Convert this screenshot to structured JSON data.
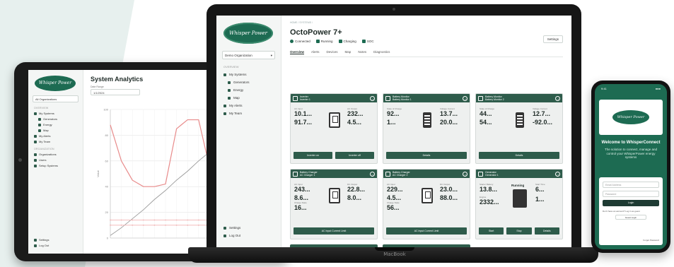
{
  "tablet": {
    "logo_text": "Whisper Power",
    "title": "System Analytics",
    "org_select": "All Organizations",
    "date_label": "Date Range",
    "date_value": "1/1/2024",
    "sidebar": {
      "section_overview": "OVERVIEW",
      "section_organization": "ORGANIZATION",
      "items": [
        {
          "label": "My Systems",
          "sub": false
        },
        {
          "label": "Generators",
          "sub": true
        },
        {
          "label": "Energy",
          "sub": true
        },
        {
          "label": "Map",
          "sub": true
        },
        {
          "label": "My Alerts",
          "sub": false
        },
        {
          "label": "My Team",
          "sub": false
        }
      ],
      "org_items": [
        {
          "label": "Organizations"
        },
        {
          "label": "Users"
        },
        {
          "label": "Setup Systems"
        }
      ],
      "bottom_items": [
        {
          "label": "Settings"
        },
        {
          "label": "Log Out"
        }
      ]
    },
    "chart_data": {
      "type": "line",
      "title": "",
      "xlabel": "",
      "ylabel": "Value",
      "x": [
        0,
        1,
        2,
        3,
        4,
        5,
        6,
        7,
        8,
        9,
        10,
        11,
        12,
        13,
        14,
        15
      ],
      "ylim": [
        0,
        100
      ],
      "yticks": [
        0,
        20,
        40,
        60,
        80,
        100
      ],
      "grid": true,
      "legend": "none",
      "series": [
        {
          "color": "#e88a8a",
          "values": [
            88,
            60,
            45,
            40,
            40,
            42,
            85,
            92,
            92,
            55,
            10,
            4,
            4,
            4,
            4,
            4
          ]
        },
        {
          "color": "#9a9a9a",
          "values": [
            2,
            8,
            15,
            22,
            30,
            37,
            45,
            52,
            60,
            67,
            75,
            82,
            88,
            93,
            97,
            99
          ]
        },
        {
          "color": "#f2b5b5",
          "values": [
            14,
            14,
            14,
            14,
            14,
            14,
            14,
            14,
            14,
            14,
            14,
            14,
            14,
            14,
            14,
            14
          ]
        },
        {
          "color": "#f2b5b5",
          "values": [
            10,
            10,
            10,
            10,
            10,
            10,
            10,
            10,
            10,
            10,
            10,
            10,
            10,
            10,
            10,
            10
          ]
        }
      ]
    }
  },
  "laptop": {
    "brand": "MacBook",
    "logo_text": "Whisper Power",
    "org_select": "Demo Organization",
    "breadcrumb": "HOME / SYSTEMS / ",
    "title": "OctoPower 7+",
    "settings_label": "Settings",
    "status": [
      {
        "label": "Connected",
        "shape": "circle"
      },
      {
        "label": "Running",
        "shape": "square"
      },
      {
        "label": "Charging",
        "shape": "square"
      },
      {
        "label": "SOC",
        "shape": "square"
      }
    ],
    "tabs": [
      "Overview",
      "Alerts",
      "Devices",
      "Map",
      "Notes",
      "Diagnostics"
    ],
    "active_tab": "Overview",
    "sidebar": {
      "section_overview": "OVERVIEW",
      "items": [
        {
          "label": "My Systems",
          "sub": false
        },
        {
          "label": "Generators",
          "sub": true
        },
        {
          "label": "Energy",
          "sub": true
        },
        {
          "label": "Map",
          "sub": true
        },
        {
          "label": "My Alerts",
          "sub": false
        },
        {
          "label": "My Team",
          "sub": false
        }
      ],
      "bottom_items": [
        {
          "label": "Settings"
        },
        {
          "label": "Log Out"
        }
      ]
    },
    "cards": [
      {
        "title": "Inverter",
        "subtitle": "Inverter 1",
        "icon": "inverter",
        "values": [
          {
            "label": "AC Input",
            "value": "10.1..."
          },
          {
            "label": "",
            "value": "91.7..."
          },
          {
            "label": "AC Output",
            "value": "232..."
          },
          {
            "label": "",
            "value": "4.5..."
          }
        ],
        "buttons": [
          "Inverter on",
          "Inverter off"
        ]
      },
      {
        "title": "Battery Monitor",
        "subtitle": "Battery Monitor 1",
        "icon": "battery",
        "values": [
          {
            "label": "State of Charge",
            "value": "92..."
          },
          {
            "label": "",
            "value": "1..."
          },
          {
            "label": "Voltage Current",
            "value": "13.7..."
          },
          {
            "label": "",
            "value": "20.0..."
          }
        ],
        "buttons": [
          "Details"
        ]
      },
      {
        "title": "Battery Monitor",
        "subtitle": "Battery Monitor 2",
        "icon": "battery",
        "values": [
          {
            "label": "State of Charge",
            "value": "44..."
          },
          {
            "label": "",
            "value": "54..."
          },
          {
            "label": "Voltage Current",
            "value": "12.7..."
          },
          {
            "label": "",
            "value": "-92.0..."
          }
        ],
        "buttons": [
          "Details"
        ]
      },
      {
        "title": "Battery Charger",
        "subtitle": "AC Charger 1",
        "icon": "charger",
        "values": [
          {
            "label": "AC Input",
            "value": "243..."
          },
          {
            "label": "",
            "value": "8.6..."
          },
          {
            "label": "DC Output",
            "value": "22.8..."
          },
          {
            "label": "",
            "value": "8.0..."
          },
          {
            "label": "Charge State",
            "value": "16..."
          }
        ],
        "buttons": [
          "AC Input Current Limit"
        ]
      },
      {
        "title": "Battery Charger",
        "subtitle": "AC Charger 2",
        "icon": "charger",
        "values": [
          {
            "label": "AC Input",
            "value": "229..."
          },
          {
            "label": "",
            "value": "4.5..."
          },
          {
            "label": "DC Output",
            "value": "23.0..."
          },
          {
            "label": "",
            "value": "88.0..."
          },
          {
            "label": "Charge State",
            "value": "56..."
          }
        ],
        "buttons": [
          "AC Input Current Limit"
        ]
      },
      {
        "title": "Generator",
        "subtitle": "Generator 1",
        "icon": "generator",
        "running_label": "Running",
        "values": [
          {
            "label": "Starter Battery",
            "value": "13.8..."
          },
          {
            "label": "Engine",
            "value": "2332..."
          },
          {
            "label": "Start Time",
            "value": "6..."
          },
          {
            "label": "",
            "value": "1..."
          }
        ],
        "buttons": [
          "Start",
          "Stop",
          "Details"
        ]
      }
    ]
  },
  "phone": {
    "time": "9:41",
    "signal": "●●●",
    "logo_text": "Whisper Power",
    "welcome": "Welcome to WhisperConnect",
    "tagline": "The solution to connect, manage and control your WhisperPower energy systems",
    "email_placeholder": "Email Address",
    "password_placeholder": "Password",
    "login_label": "Login",
    "account_text": "Don't have an account? Log in as guest",
    "guest_label": "Guest Login",
    "forgot_label": "Forgot Password"
  },
  "colors": {
    "brand_green": "#1d6b52",
    "card_header": "#2e5c4b",
    "bg_shape": "#e7f0ee"
  }
}
